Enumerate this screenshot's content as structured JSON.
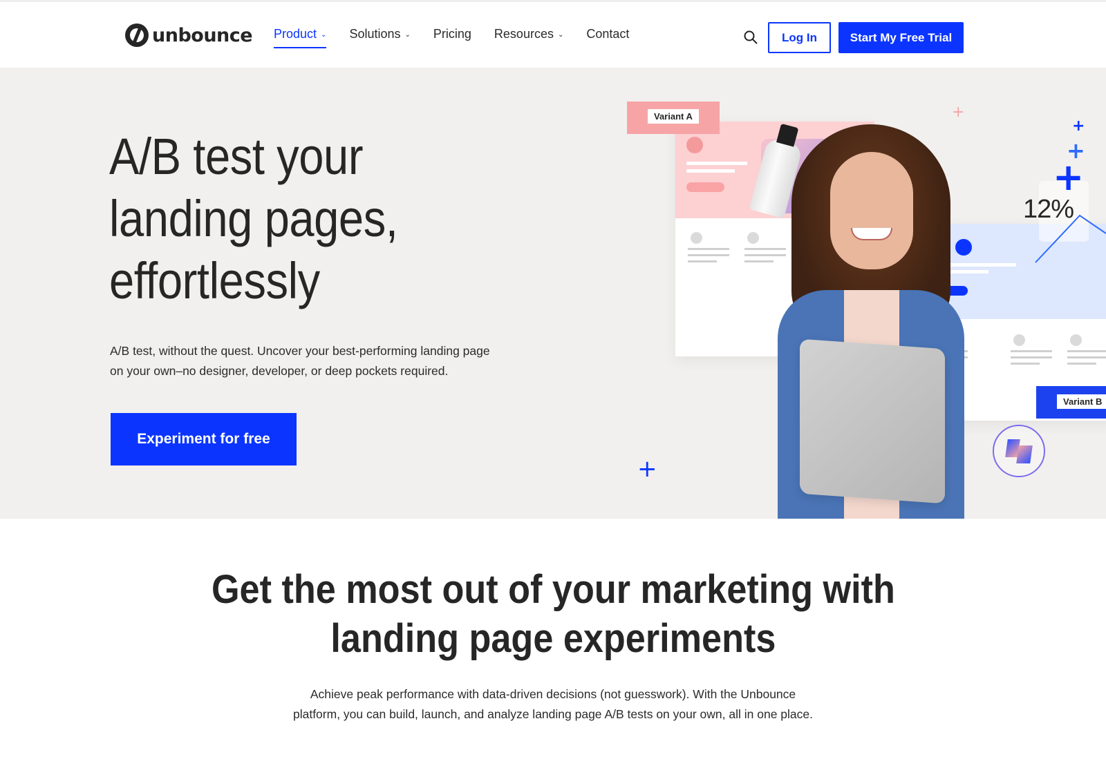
{
  "brand": {
    "name": "unbounce",
    "accent": "#0b35ff",
    "hero_bg": "#f1f0ee"
  },
  "nav": {
    "links": [
      {
        "label": "Product",
        "has_dropdown": true,
        "active": true
      },
      {
        "label": "Solutions",
        "has_dropdown": true,
        "active": false
      },
      {
        "label": "Pricing",
        "has_dropdown": false,
        "active": false
      },
      {
        "label": "Resources",
        "has_dropdown": true,
        "active": false
      },
      {
        "label": "Contact",
        "has_dropdown": false,
        "active": false
      }
    ],
    "dropdown_glyph": "⌄",
    "search_icon": "search-icon",
    "login_label": "Log In",
    "trial_label": "Start My Free Trial"
  },
  "hero": {
    "title_lines": [
      "A/B test your",
      "landing pages,",
      "effortlessly"
    ],
    "subtitle_lines": [
      "A/B test, without the quest. Uncover your best-performing landing page",
      "on your own–no designer, developer, or deep pockets required."
    ],
    "cta_label": "Experiment for free",
    "illustration": {
      "variant_a_label": "Variant A",
      "variant_b_label": "Variant B",
      "stat_label": "12%",
      "colors": {
        "variant_a": "#f7a4a6",
        "variant_b": "#1c42f0"
      }
    }
  },
  "section": {
    "title_lines": [
      "Get the most out of your marketing with",
      "landing page experiments"
    ],
    "subtitle_lines": [
      "Achieve peak performance with data-driven decisions (not guesswork). With the Unbounce",
      "platform, you can build, launch, and analyze landing page A/B tests on your own, all in one place."
    ]
  }
}
